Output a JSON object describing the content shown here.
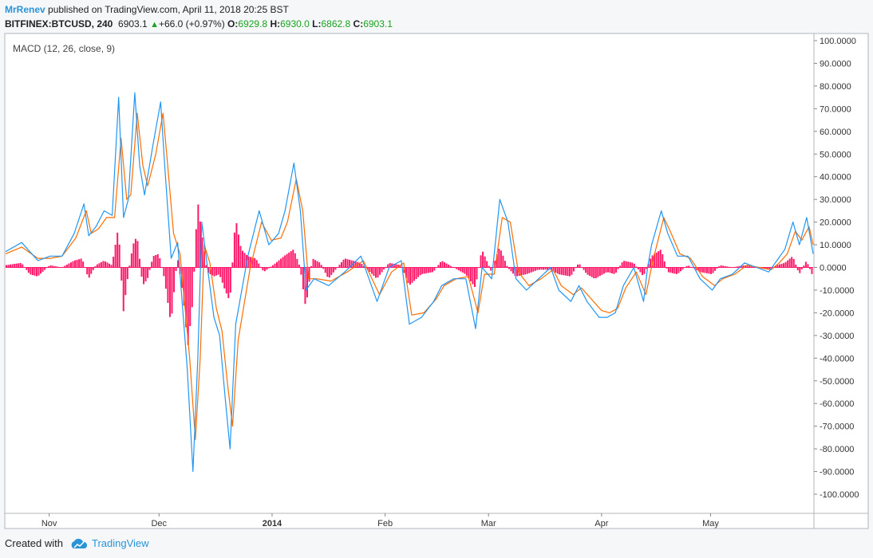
{
  "header": {
    "author": "MrRenev",
    "published": "published on TradingView.com, April 11, 2018 20:25 BST"
  },
  "symbol_line": {
    "symbol": "BITFINEX:BTCUSD, 240",
    "price": "6903.1",
    "change": "+66.0 (+0.97%)",
    "open_label": "O:",
    "open": "6929.8",
    "high_label": "H:",
    "high": "6930.0",
    "low_label": "L:",
    "low": "6862.8",
    "close_label": "C:",
    "close": "6903.1"
  },
  "footer": {
    "created_with": "Created with",
    "brand": "TradingView"
  },
  "colors": {
    "macd": "#2196f3",
    "signal": "#ff6d00",
    "histogram": "#ff1a6a",
    "up": "#19a31f",
    "brand": "#2a94d6"
  },
  "chart_data": {
    "type": "line",
    "title": "MACD (12, 26, close, 9)",
    "ylim": [
      -100,
      100
    ],
    "y_ticks": [
      "100.0000",
      "90.0000",
      "80.0000",
      "70.0000",
      "60.0000",
      "50.0000",
      "40.0000",
      "30.0000",
      "20.0000",
      "10.0000",
      "0.0000",
      "-10.0000",
      "-20.0000",
      "-30.0000",
      "-40.0000",
      "-50.0000",
      "-60.0000",
      "-70.0000",
      "-80.0000",
      "-90.0000",
      "-100.0000"
    ],
    "x_ticks": [
      {
        "label": "Nov",
        "t": 0.054,
        "bold": false
      },
      {
        "label": "Dec",
        "t": 0.19,
        "bold": false
      },
      {
        "label": "2014",
        "t": 0.33,
        "bold": true
      },
      {
        "label": "Feb",
        "t": 0.47,
        "bold": false
      },
      {
        "label": "Mar",
        "t": 0.598,
        "bold": false
      },
      {
        "label": "Apr",
        "t": 0.738,
        "bold": false
      },
      {
        "label": "May",
        "t": 0.873,
        "bold": false
      }
    ],
    "series": [
      {
        "name": "MACD",
        "points": [
          [
            0,
            7
          ],
          [
            0.02,
            11
          ],
          [
            0.04,
            3
          ],
          [
            0.055,
            5
          ],
          [
            0.07,
            5
          ],
          [
            0.085,
            15
          ],
          [
            0.097,
            28
          ],
          [
            0.103,
            14
          ],
          [
            0.112,
            18
          ],
          [
            0.122,
            25
          ],
          [
            0.132,
            23
          ],
          [
            0.14,
            75
          ],
          [
            0.146,
            22
          ],
          [
            0.152,
            30
          ],
          [
            0.16,
            77
          ],
          [
            0.166,
            45
          ],
          [
            0.172,
            32
          ],
          [
            0.183,
            55
          ],
          [
            0.192,
            73
          ],
          [
            0.197,
            45
          ],
          [
            0.205,
            4
          ],
          [
            0.213,
            11
          ],
          [
            0.225,
            -45
          ],
          [
            0.232,
            -90
          ],
          [
            0.238,
            -40
          ],
          [
            0.243,
            20
          ],
          [
            0.25,
            0
          ],
          [
            0.258,
            -22
          ],
          [
            0.265,
            -30
          ],
          [
            0.272,
            -58
          ],
          [
            0.278,
            -80
          ],
          [
            0.285,
            -25
          ],
          [
            0.3,
            5
          ],
          [
            0.314,
            25
          ],
          [
            0.326,
            10
          ],
          [
            0.338,
            15
          ],
          [
            0.346,
            25
          ],
          [
            0.357,
            46
          ],
          [
            0.365,
            25
          ],
          [
            0.372,
            -10
          ],
          [
            0.382,
            -5
          ],
          [
            0.4,
            -8
          ],
          [
            0.42,
            -2
          ],
          [
            0.44,
            5
          ],
          [
            0.46,
            -15
          ],
          [
            0.475,
            0
          ],
          [
            0.49,
            3
          ],
          [
            0.5,
            -25
          ],
          [
            0.515,
            -22
          ],
          [
            0.53,
            -15
          ],
          [
            0.54,
            -8
          ],
          [
            0.555,
            -5
          ],
          [
            0.57,
            -5
          ],
          [
            0.582,
            -27
          ],
          [
            0.59,
            0
          ],
          [
            0.602,
            -5
          ],
          [
            0.612,
            30
          ],
          [
            0.622,
            20
          ],
          [
            0.632,
            -5
          ],
          [
            0.645,
            -10
          ],
          [
            0.66,
            -5
          ],
          [
            0.675,
            0
          ],
          [
            0.685,
            -10
          ],
          [
            0.7,
            -15
          ],
          [
            0.71,
            -8
          ],
          [
            0.72,
            -15
          ],
          [
            0.735,
            -22
          ],
          [
            0.745,
            -22
          ],
          [
            0.755,
            -20
          ],
          [
            0.765,
            -8
          ],
          [
            0.778,
            0
          ],
          [
            0.79,
            -15
          ],
          [
            0.795,
            0
          ],
          [
            0.8,
            10
          ],
          [
            0.812,
            25
          ],
          [
            0.82,
            15
          ],
          [
            0.832,
            5
          ],
          [
            0.845,
            5
          ],
          [
            0.86,
            -5
          ],
          [
            0.875,
            -10
          ],
          [
            0.885,
            -5
          ],
          [
            0.9,
            -3
          ],
          [
            0.915,
            2
          ],
          [
            0.93,
            0
          ],
          [
            0.945,
            -2
          ],
          [
            0.955,
            3
          ],
          [
            0.965,
            8
          ],
          [
            0.975,
            20
          ],
          [
            0.983,
            10
          ],
          [
            0.992,
            22
          ],
          [
            1.0,
            6
          ]
        ]
      },
      {
        "name": "Signal",
        "points": [
          [
            0,
            6
          ],
          [
            0.02,
            9
          ],
          [
            0.04,
            4
          ],
          [
            0.055,
            4
          ],
          [
            0.07,
            5
          ],
          [
            0.087,
            13
          ],
          [
            0.1,
            25
          ],
          [
            0.106,
            15
          ],
          [
            0.115,
            17
          ],
          [
            0.125,
            22
          ],
          [
            0.135,
            22
          ],
          [
            0.143,
            57
          ],
          [
            0.15,
            30
          ],
          [
            0.155,
            32
          ],
          [
            0.163,
            68
          ],
          [
            0.17,
            45
          ],
          [
            0.176,
            36
          ],
          [
            0.186,
            50
          ],
          [
            0.195,
            68
          ],
          [
            0.2,
            48
          ],
          [
            0.208,
            15
          ],
          [
            0.216,
            6
          ],
          [
            0.228,
            -40
          ],
          [
            0.235,
            -76
          ],
          [
            0.241,
            -40
          ],
          [
            0.246,
            10
          ],
          [
            0.253,
            2
          ],
          [
            0.261,
            -18
          ],
          [
            0.268,
            -28
          ],
          [
            0.275,
            -52
          ],
          [
            0.281,
            -70
          ],
          [
            0.288,
            -32
          ],
          [
            0.303,
            0
          ],
          [
            0.317,
            20
          ],
          [
            0.329,
            12
          ],
          [
            0.341,
            13
          ],
          [
            0.349,
            20
          ],
          [
            0.36,
            39
          ],
          [
            0.368,
            25
          ],
          [
            0.375,
            -5
          ],
          [
            0.385,
            -5
          ],
          [
            0.403,
            -6
          ],
          [
            0.423,
            -2
          ],
          [
            0.443,
            3
          ],
          [
            0.463,
            -12
          ],
          [
            0.478,
            -2
          ],
          [
            0.493,
            2
          ],
          [
            0.503,
            -21
          ],
          [
            0.518,
            -20
          ],
          [
            0.533,
            -14
          ],
          [
            0.543,
            -8
          ],
          [
            0.558,
            -5
          ],
          [
            0.573,
            -4
          ],
          [
            0.585,
            -20
          ],
          [
            0.593,
            -3
          ],
          [
            0.605,
            -3
          ],
          [
            0.615,
            22
          ],
          [
            0.625,
            20
          ],
          [
            0.635,
            -2
          ],
          [
            0.648,
            -8
          ],
          [
            0.663,
            -5
          ],
          [
            0.678,
            -1
          ],
          [
            0.688,
            -8
          ],
          [
            0.703,
            -12
          ],
          [
            0.713,
            -9
          ],
          [
            0.723,
            -13
          ],
          [
            0.738,
            -19
          ],
          [
            0.748,
            -20
          ],
          [
            0.758,
            -18
          ],
          [
            0.768,
            -9
          ],
          [
            0.781,
            -2
          ],
          [
            0.793,
            -12
          ],
          [
            0.798,
            -3
          ],
          [
            0.803,
            5
          ],
          [
            0.815,
            22
          ],
          [
            0.823,
            16
          ],
          [
            0.835,
            6
          ],
          [
            0.848,
            4
          ],
          [
            0.863,
            -4
          ],
          [
            0.878,
            -8
          ],
          [
            0.888,
            -5
          ],
          [
            0.903,
            -3
          ],
          [
            0.918,
            1
          ],
          [
            0.933,
            0
          ],
          [
            0.948,
            -1
          ],
          [
            0.958,
            2
          ],
          [
            0.968,
            6
          ],
          [
            0.978,
            16
          ],
          [
            0.986,
            12
          ],
          [
            0.995,
            18
          ],
          [
            1.0,
            10
          ]
        ]
      },
      {
        "name": "Histogram",
        "points": [
          [
            0,
            1
          ],
          [
            0.02,
            2
          ],
          [
            0.03,
            -3
          ],
          [
            0.04,
            -4
          ],
          [
            0.055,
            1
          ],
          [
            0.07,
            0
          ],
          [
            0.085,
            3
          ],
          [
            0.095,
            4
          ],
          [
            0.103,
            -5
          ],
          [
            0.112,
            1
          ],
          [
            0.122,
            3
          ],
          [
            0.132,
            1
          ],
          [
            0.14,
            18
          ],
          [
            0.146,
            -20
          ],
          [
            0.152,
            -3
          ],
          [
            0.158,
            10
          ],
          [
            0.163,
            14
          ],
          [
            0.17,
            -8
          ],
          [
            0.176,
            -5
          ],
          [
            0.183,
            5
          ],
          [
            0.19,
            6
          ],
          [
            0.197,
            -5
          ],
          [
            0.205,
            -25
          ],
          [
            0.213,
            5
          ],
          [
            0.22,
            -12
          ],
          [
            0.226,
            -35
          ],
          [
            0.232,
            -15
          ],
          [
            0.238,
            30
          ],
          [
            0.243,
            15
          ],
          [
            0.25,
            -2
          ],
          [
            0.258,
            -4
          ],
          [
            0.265,
            -3
          ],
          [
            0.272,
            -10
          ],
          [
            0.278,
            -15
          ],
          [
            0.285,
            22
          ],
          [
            0.292,
            8
          ],
          [
            0.3,
            5
          ],
          [
            0.31,
            4
          ],
          [
            0.32,
            -2
          ],
          [
            0.335,
            2
          ],
          [
            0.345,
            5
          ],
          [
            0.357,
            8
          ],
          [
            0.365,
            0
          ],
          [
            0.372,
            -18
          ],
          [
            0.38,
            4
          ],
          [
            0.39,
            2
          ],
          [
            0.4,
            -5
          ],
          [
            0.42,
            4
          ],
          [
            0.44,
            2
          ],
          [
            0.46,
            -5
          ],
          [
            0.475,
            2
          ],
          [
            0.49,
            1
          ],
          [
            0.5,
            -8
          ],
          [
            0.515,
            -3
          ],
          [
            0.53,
            -2
          ],
          [
            0.54,
            3
          ],
          [
            0.555,
            0
          ],
          [
            0.57,
            -3
          ],
          [
            0.582,
            -9
          ],
          [
            0.59,
            8
          ],
          [
            0.602,
            -2
          ],
          [
            0.608,
            5
          ],
          [
            0.612,
            9
          ],
          [
            0.622,
            0
          ],
          [
            0.632,
            -4
          ],
          [
            0.645,
            -3
          ],
          [
            0.66,
            -1
          ],
          [
            0.675,
            -1
          ],
          [
            0.685,
            -3
          ],
          [
            0.7,
            -4
          ],
          [
            0.71,
            2
          ],
          [
            0.72,
            -3
          ],
          [
            0.73,
            -5
          ],
          [
            0.745,
            -2
          ],
          [
            0.755,
            -3
          ],
          [
            0.765,
            3
          ],
          [
            0.778,
            2
          ],
          [
            0.79,
            -4
          ],
          [
            0.8,
            5
          ],
          [
            0.812,
            8
          ],
          [
            0.82,
            -2
          ],
          [
            0.832,
            -3
          ],
          [
            0.845,
            1
          ],
          [
            0.86,
            -2
          ],
          [
            0.875,
            -3
          ],
          [
            0.885,
            1
          ],
          [
            0.9,
            0
          ],
          [
            0.915,
            1
          ],
          [
            0.93,
            0
          ],
          [
            0.945,
            -1
          ],
          [
            0.955,
            1
          ],
          [
            0.965,
            2
          ],
          [
            0.975,
            5
          ],
          [
            0.983,
            -3
          ],
          [
            0.992,
            3
          ],
          [
            1.0,
            -4
          ]
        ]
      }
    ]
  }
}
